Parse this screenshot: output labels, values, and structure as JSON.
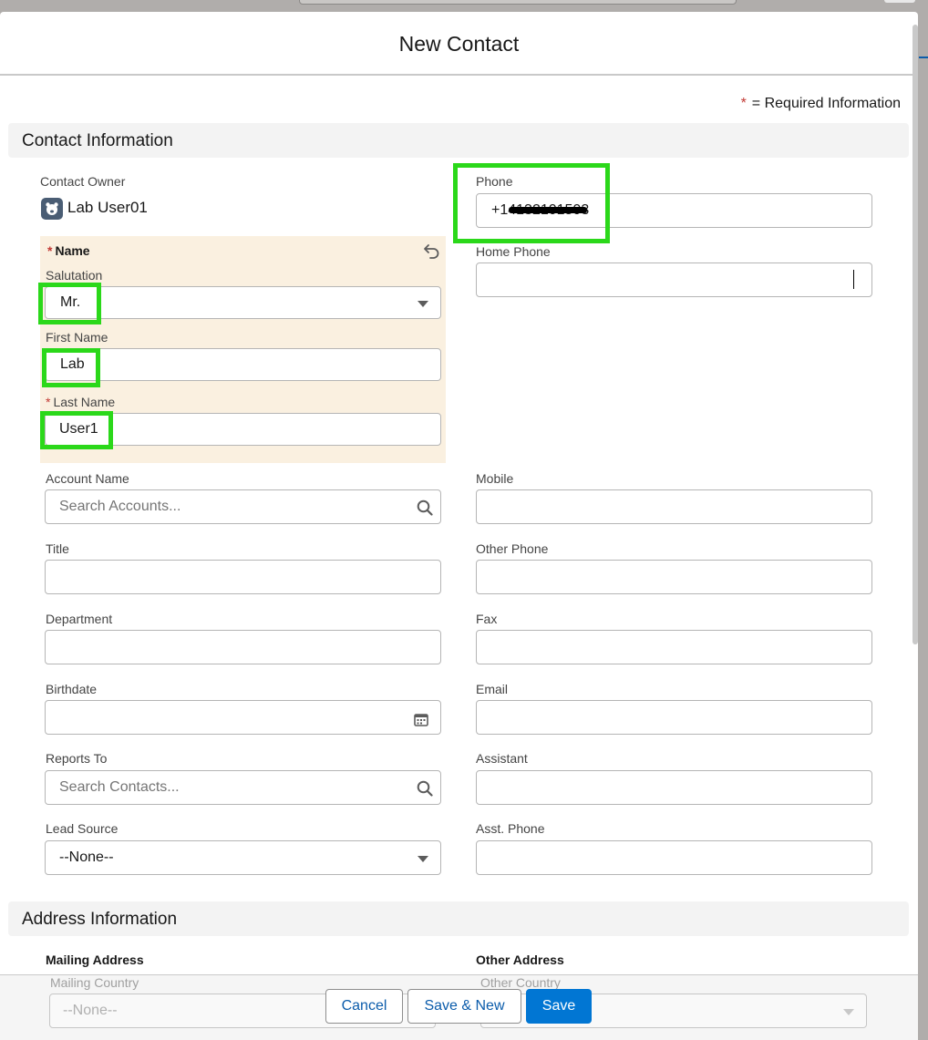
{
  "modal": {
    "title": "New Contact"
  },
  "required_note": {
    "star": "*",
    "text": "= Required Information"
  },
  "contact_section": {
    "title": "Contact Information",
    "owner": {
      "label": "Contact Owner",
      "value": "Lab User01"
    },
    "name": {
      "title": "Name",
      "salutation": {
        "label": "Salutation",
        "value": "Mr."
      },
      "first_name": {
        "label": "First Name",
        "value": "Lab"
      },
      "last_name": {
        "label": "Last Name",
        "value": "User1"
      }
    },
    "phone": {
      "label": "Phone",
      "value": "+14132101503"
    },
    "home_phone": {
      "label": "Home Phone",
      "value": ""
    },
    "account_name": {
      "label": "Account Name",
      "placeholder": "Search Accounts..."
    },
    "mobile": {
      "label": "Mobile",
      "value": ""
    },
    "title_field": {
      "label": "Title",
      "value": ""
    },
    "other_phone": {
      "label": "Other Phone",
      "value": ""
    },
    "department": {
      "label": "Department",
      "value": ""
    },
    "fax": {
      "label": "Fax",
      "value": ""
    },
    "birthdate": {
      "label": "Birthdate",
      "value": ""
    },
    "email": {
      "label": "Email",
      "value": ""
    },
    "reports_to": {
      "label": "Reports To",
      "placeholder": "Search Contacts..."
    },
    "assistant": {
      "label": "Assistant",
      "value": ""
    },
    "lead_source": {
      "label": "Lead Source",
      "value": "--None--"
    },
    "asst_phone": {
      "label": "Asst. Phone",
      "value": ""
    }
  },
  "address_section": {
    "title": "Address Information",
    "mailing": {
      "label": "Mailing Address",
      "country_label": "Mailing Country",
      "country_value": "--None--"
    },
    "other": {
      "label": "Other Address",
      "country_label": "Other Country"
    }
  },
  "footer": {
    "cancel": "Cancel",
    "save_new": "Save & New",
    "save": "Save"
  },
  "colors": {
    "primary": "#0176d3",
    "required": "#c23934",
    "highlight": "#2bd81a",
    "name_bg": "#faf0e0"
  }
}
